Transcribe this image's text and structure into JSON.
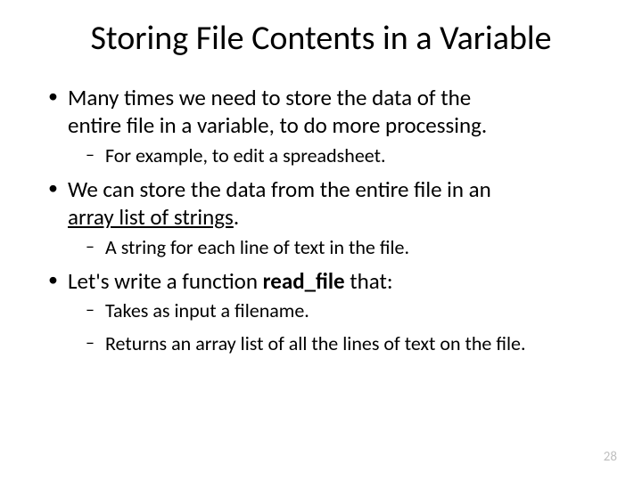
{
  "title": "Storing File Contents in a Variable",
  "bullets": {
    "b1a": "Many times we need to store the data of the",
    "b1b": "entire file in a variable, to do more processing.",
    "b1_1": "For example, to edit a spreadsheet.",
    "b2a": "We can store the data from the entire file in an",
    "b2b_u": "array list of strings",
    "b2b_tail": ".",
    "b2_1": "A string for each line of text in the file.",
    "b3a": "Let's write a function ",
    "b3_bold": "read_file",
    "b3b": " that:",
    "b3_1": "Takes as input a filename.",
    "b3_2": "Returns an array list of all the lines of text on the file."
  },
  "page_number": "28"
}
